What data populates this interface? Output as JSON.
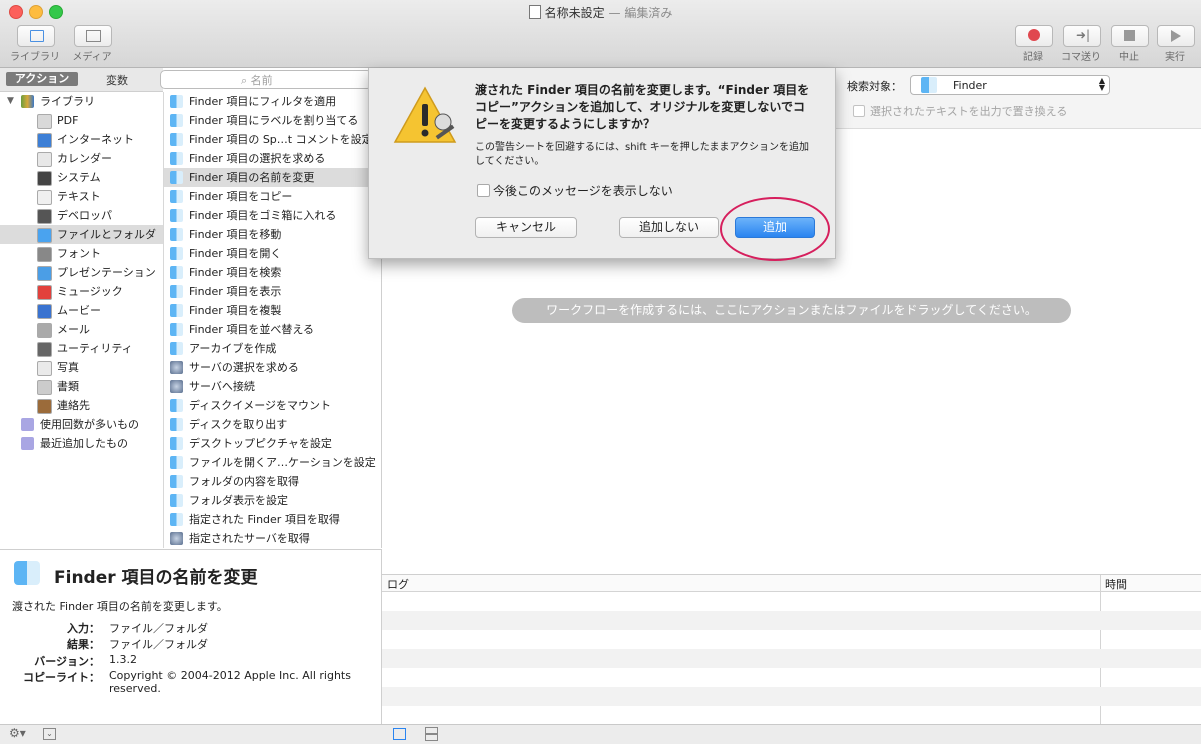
{
  "window": {
    "title": "名称未設定",
    "title_sep": " — ",
    "title_state": "編集済み"
  },
  "toolbar": {
    "left": [
      {
        "label": "ライブラリ",
        "icon": "library-icon"
      },
      {
        "label": "メディア",
        "icon": "media-icon"
      }
    ],
    "right": [
      {
        "label": "記録",
        "icon": "record-icon"
      },
      {
        "label": "コマ送り",
        "icon": "step-icon"
      },
      {
        "label": "中止",
        "icon": "stop-icon"
      },
      {
        "label": "実行",
        "icon": "run-icon"
      }
    ]
  },
  "tabs": {
    "actions": "アクション",
    "variables": "変数"
  },
  "search": {
    "placeholder": "名前"
  },
  "library": {
    "root": "ライブラリ",
    "items": [
      "PDF",
      "インターネット",
      "カレンダー",
      "システム",
      "テキスト",
      "デベロッパ",
      "ファイルとフォルダ",
      "フォント",
      "プレゼンテーション",
      "ミュージック",
      "ムービー",
      "メール",
      "ユーティリティ",
      "写真",
      "書類",
      "連絡先"
    ],
    "extra": [
      "使用回数が多いもの",
      "最近追加したもの"
    ],
    "selected_index": 6
  },
  "actions": {
    "items": [
      "Finder 項目にフィルタを適用",
      "Finder 項目にラベルを割り当てる",
      "Finder 項目の Sp…t コメントを設定",
      "Finder 項目の選択を求める",
      "Finder 項目の名前を変更",
      "Finder 項目をコピー",
      "Finder 項目をゴミ箱に入れる",
      "Finder 項目を移動",
      "Finder 項目を開く",
      "Finder 項目を検索",
      "Finder 項目を表示",
      "Finder 項目を複製",
      "Finder 項目を並べ替える",
      "アーカイブを作成",
      "サーバの選択を求める",
      "サーバへ接続",
      "ディスクイメージをマウント",
      "ディスクを取り出す",
      "デスクトップピクチャを設定",
      "ファイルを開くア…ケーションを設定",
      "フォルダの内容を取得",
      "フォルダ表示を設定",
      "指定された Finder 項目を取得",
      "指定されたサーバを取得"
    ],
    "selected_index": 4
  },
  "description": {
    "title": "Finder 項目の名前を変更",
    "summary": "渡された Finder 項目の名前を変更します。",
    "input_label": "入力：",
    "input_value": "ファイル／フォルダ",
    "result_label": "結果：",
    "result_value": "ファイル／フォルダ",
    "version_label": "バージョン：",
    "version_value": "1.3.2",
    "copyright_label": "コピーライト：",
    "copyright_value": "Copyright © 2004-2012 Apple Inc.  All rights reserved."
  },
  "workflow": {
    "search_target_label": "検索対象：",
    "search_target_value": "Finder",
    "replace_checkbox_label": "選択されたテキストを出力で置き換える",
    "hint": "ワークフローを作成するには、ここにアクションまたはファイルをドラッグしてください。"
  },
  "log": {
    "col_log": "ログ",
    "col_time": "時間"
  },
  "dialog": {
    "message": "渡された Finder 項目の名前を変更します。“Finder 項目をコピー”アクションを追加して、オリジナルを変更しないでコピーを変更するようにしますか？",
    "informative": "この警告シートを回避するには、shift キーを押したままアクションを追加してください。",
    "checkbox_label": "今後このメッセージを表示しない",
    "cancel": "キャンセル",
    "dont_add": "追加しない",
    "add": "追加"
  },
  "colors": {
    "accent": "#2a84f0",
    "highlight_ring": "#d61f5d"
  }
}
